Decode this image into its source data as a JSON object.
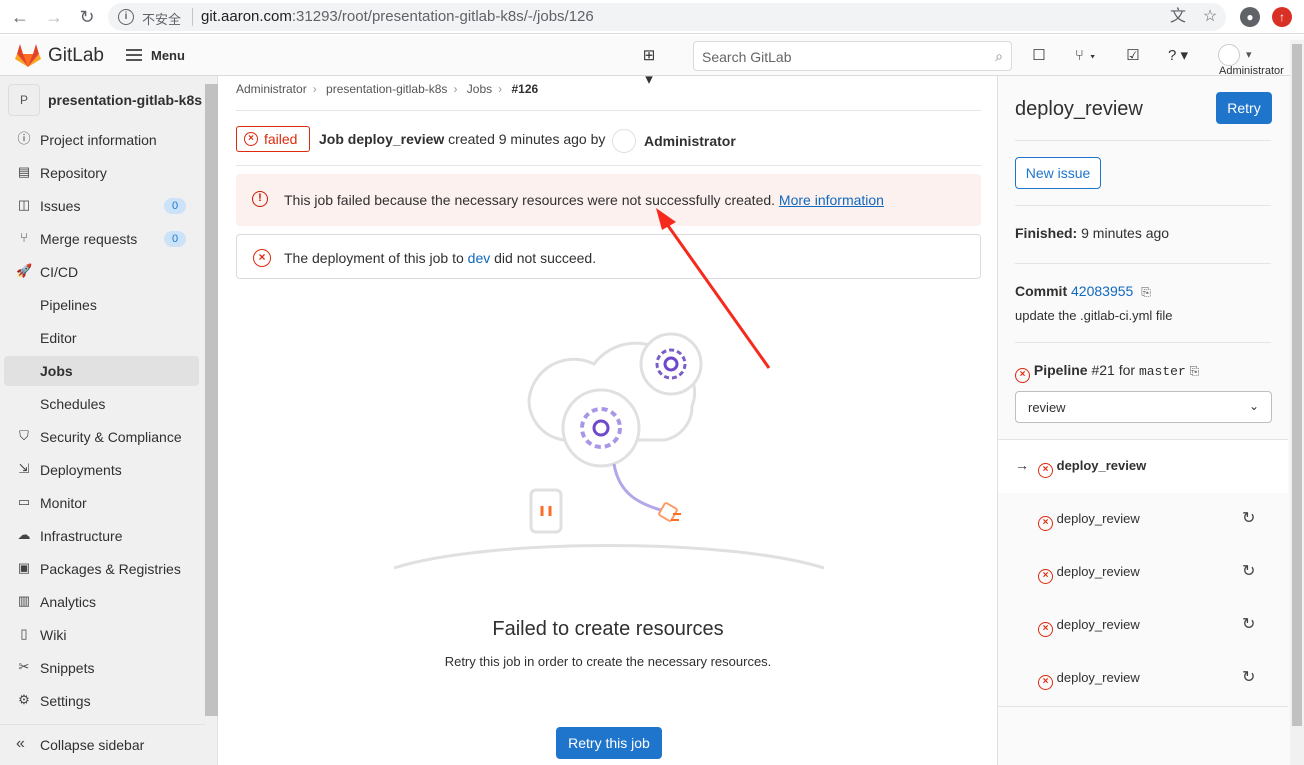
{
  "browser": {
    "insecure_label": "不安全",
    "url_host": "git.aaron.com",
    "url_path": ":31293/root/presentation-gitlab-k8s/-/jobs/126"
  },
  "header": {
    "brand": "GitLab",
    "menu_label": "Menu",
    "search_placeholder": "Search GitLab",
    "user_label": "Administrator"
  },
  "sidebar": {
    "project_initial": "P",
    "project_name": "presentation-gitlab-k8s",
    "items": [
      {
        "label": "Project information",
        "icon": "info-icon"
      },
      {
        "label": "Repository",
        "icon": "doc-icon"
      },
      {
        "label": "Issues",
        "icon": "issues-icon",
        "badge": "0"
      },
      {
        "label": "Merge requests",
        "icon": "merge-icon",
        "badge": "0"
      },
      {
        "label": "CI/CD",
        "icon": "rocket-icon"
      },
      {
        "label": "Pipelines"
      },
      {
        "label": "Editor"
      },
      {
        "label": "Jobs"
      },
      {
        "label": "Schedules"
      },
      {
        "label": "Security & Compliance",
        "icon": "shield-icon"
      },
      {
        "label": "Deployments",
        "icon": "deploy-icon"
      },
      {
        "label": "Monitor",
        "icon": "monitor-icon"
      },
      {
        "label": "Infrastructure",
        "icon": "cloud-icon"
      },
      {
        "label": "Packages & Registries",
        "icon": "package-icon"
      },
      {
        "label": "Analytics",
        "icon": "chart-icon"
      },
      {
        "label": "Wiki",
        "icon": "book-icon"
      },
      {
        "label": "Snippets",
        "icon": "scissors-icon"
      },
      {
        "label": "Settings",
        "icon": "gear-icon"
      }
    ],
    "collapse_label": "Collapse sidebar"
  },
  "breadcrumb": [
    "Administrator",
    "presentation-gitlab-k8s",
    "Jobs",
    "#126"
  ],
  "job": {
    "status": "failed",
    "title_prefix": "Job",
    "job_name": "deploy_review",
    "created": "created 9 minutes ago by",
    "author": "Administrator"
  },
  "alert": {
    "text": "This job failed because the necessary resources were not successfully created.",
    "link": "More information"
  },
  "deploy": {
    "text_before": "The deployment of this job to",
    "env": "dev",
    "text_after": "did not succeed."
  },
  "empty": {
    "title": "Failed to create resources",
    "description": "Retry this job in order to create the necessary resources.",
    "button": "Retry this job"
  },
  "right": {
    "title": "deploy_review",
    "retry": "Retry",
    "new_issue": "New issue",
    "finished_label": "Finished:",
    "finished_value": "9 minutes ago",
    "commit_label": "Commit",
    "commit_sha": "42083955",
    "commit_message": "update the .gitlab-ci.yml file",
    "pipeline_label": "Pipeline",
    "pipeline_id": "#21",
    "pipeline_for": "for",
    "pipeline_ref": "master",
    "stage": "review",
    "jobs": [
      "deploy_review",
      "deploy_review",
      "deploy_review",
      "deploy_review",
      "deploy_review"
    ]
  },
  "colors": {
    "danger": "#dd2b0e",
    "link": "#1068bf",
    "primary_button": "#1f75cb",
    "annotation_arrow": "#f5291c"
  }
}
